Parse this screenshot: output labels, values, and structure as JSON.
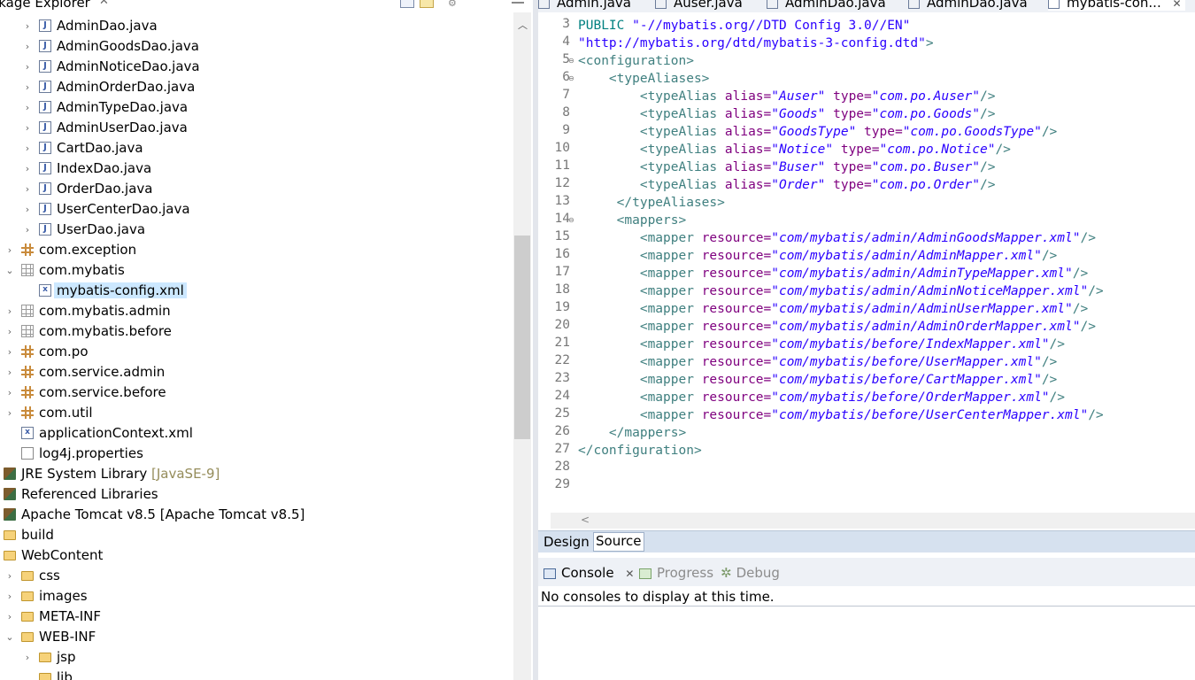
{
  "package_explorer": {
    "title": "ckage Explorer",
    "tree": [
      {
        "label": "AdminDao.java",
        "icon": "java-file-icon",
        "indent": 2,
        "twisty": "collapsed"
      },
      {
        "label": "AdminGoodsDao.java",
        "icon": "java-file-icon",
        "indent": 2,
        "twisty": "collapsed"
      },
      {
        "label": "AdminNoticeDao.java",
        "icon": "java-file-icon",
        "indent": 2,
        "twisty": "collapsed"
      },
      {
        "label": "AdminOrderDao.java",
        "icon": "java-file-icon",
        "indent": 2,
        "twisty": "collapsed"
      },
      {
        "label": "AdminTypeDao.java",
        "icon": "java-file-icon",
        "indent": 2,
        "twisty": "collapsed"
      },
      {
        "label": "AdminUserDao.java",
        "icon": "java-file-icon",
        "indent": 2,
        "twisty": "collapsed"
      },
      {
        "label": "CartDao.java",
        "icon": "java-file-icon",
        "indent": 2,
        "twisty": "collapsed"
      },
      {
        "label": "IndexDao.java",
        "icon": "java-file-icon",
        "indent": 2,
        "twisty": "collapsed"
      },
      {
        "label": "OrderDao.java",
        "icon": "java-file-icon",
        "indent": 2,
        "twisty": "collapsed"
      },
      {
        "label": "UserCenterDao.java",
        "icon": "java-file-icon",
        "indent": 2,
        "twisty": "collapsed"
      },
      {
        "label": "UserDao.java",
        "icon": "java-file-icon",
        "indent": 2,
        "twisty": "collapsed"
      },
      {
        "label": "com.exception",
        "icon": "package-icon",
        "indent": 1,
        "twisty": "collapsed"
      },
      {
        "label": "com.mybatis",
        "icon": "empty-package-icon",
        "indent": 1,
        "twisty": "expanded"
      },
      {
        "label": "mybatis-config.xml",
        "icon": "xml-file-icon",
        "indent": 2,
        "twisty": "none",
        "selected": true
      },
      {
        "label": "com.mybatis.admin",
        "icon": "empty-package-icon",
        "indent": 1,
        "twisty": "collapsed"
      },
      {
        "label": "com.mybatis.before",
        "icon": "empty-package-icon",
        "indent": 1,
        "twisty": "collapsed"
      },
      {
        "label": "com.po",
        "icon": "package-icon",
        "indent": 1,
        "twisty": "collapsed"
      },
      {
        "label": "com.service.admin",
        "icon": "package-icon",
        "indent": 1,
        "twisty": "collapsed"
      },
      {
        "label": "com.service.before",
        "icon": "package-icon",
        "indent": 1,
        "twisty": "collapsed"
      },
      {
        "label": "com.util",
        "icon": "package-icon",
        "indent": 1,
        "twisty": "collapsed"
      },
      {
        "label": "applicationContext.xml",
        "icon": "xml-file-icon",
        "indent": 1,
        "twisty": "none"
      },
      {
        "label": "log4j.properties",
        "icon": "properties-file-icon",
        "indent": 1,
        "twisty": "none"
      },
      {
        "label": "JRE System Library",
        "decoration": "[JavaSE-9]",
        "icon": "library-icon",
        "indent": 0,
        "twisty": "none"
      },
      {
        "label": "Referenced Libraries",
        "icon": "library-icon",
        "indent": 0,
        "twisty": "none"
      },
      {
        "label": "Apache Tomcat v8.5 [Apache Tomcat v8.5]",
        "icon": "library-icon",
        "indent": 0,
        "twisty": "none"
      },
      {
        "label": "build",
        "icon": "folder-icon",
        "indent": 0,
        "twisty": "none"
      },
      {
        "label": "WebContent",
        "icon": "folder-icon",
        "indent": 0,
        "twisty": "none"
      },
      {
        "label": "css",
        "icon": "folder-icon",
        "indent": 1,
        "twisty": "collapsed"
      },
      {
        "label": "images",
        "icon": "folder-icon",
        "indent": 1,
        "twisty": "collapsed"
      },
      {
        "label": "META-INF",
        "icon": "folder-icon",
        "indent": 1,
        "twisty": "collapsed"
      },
      {
        "label": "WEB-INF",
        "icon": "folder-icon",
        "indent": 1,
        "twisty": "expanded"
      },
      {
        "label": "jsp",
        "icon": "folder-icon",
        "indent": 2,
        "twisty": "collapsed"
      },
      {
        "label": "lib",
        "icon": "folder-icon",
        "indent": 2,
        "twisty": "none"
      }
    ]
  },
  "editor_tabs": [
    {
      "label": "Admin.java",
      "active": false
    },
    {
      "label": "Auser.java",
      "active": false
    },
    {
      "label": "AdminDao.java",
      "active": false
    },
    {
      "label": "AdminDao.java",
      "active": false
    },
    {
      "label": "mybatis-con...",
      "active": true
    }
  ],
  "code_lines": [
    {
      "n": "3",
      "fold": false,
      "tokens": [
        [
          "dt",
          "PUBLIC "
        ],
        [
          "str",
          "\"-//mybatis.org//DTD Config 3.0//EN\""
        ]
      ]
    },
    {
      "n": "4",
      "fold": false,
      "tokens": [
        [
          "str",
          "\"http://mybatis.org/dtd/mybatis-3-config.dtd\""
        ],
        [
          "tag",
          ">"
        ]
      ]
    },
    {
      "n": "5",
      "fold": true,
      "tokens": [
        [
          "tag",
          "<configuration>"
        ]
      ]
    },
    {
      "n": "6",
      "fold": true,
      "tokens": [
        [
          "plain",
          "    "
        ],
        [
          "tag",
          "<typeAliases>"
        ]
      ]
    },
    {
      "n": "7",
      "fold": false,
      "tokens": [
        [
          "plain",
          "        "
        ],
        [
          "tag",
          "<typeAlias "
        ],
        [
          "attr",
          "alias="
        ],
        [
          "val",
          "\"Auser\""
        ],
        [
          "plain",
          " "
        ],
        [
          "attr",
          "type="
        ],
        [
          "val",
          "\"com.po.Auser\""
        ],
        [
          "tag",
          "/>"
        ]
      ]
    },
    {
      "n": "8",
      "fold": false,
      "tokens": [
        [
          "plain",
          "        "
        ],
        [
          "tag",
          "<typeAlias "
        ],
        [
          "attr",
          "alias="
        ],
        [
          "val",
          "\"Goods\""
        ],
        [
          "plain",
          " "
        ],
        [
          "attr",
          "type="
        ],
        [
          "val",
          "\"com.po.Goods\""
        ],
        [
          "tag",
          "/>"
        ]
      ]
    },
    {
      "n": "9",
      "fold": false,
      "tokens": [
        [
          "plain",
          "        "
        ],
        [
          "tag",
          "<typeAlias "
        ],
        [
          "attr",
          "alias="
        ],
        [
          "val",
          "\"GoodsType\""
        ],
        [
          "plain",
          " "
        ],
        [
          "attr",
          "type="
        ],
        [
          "val",
          "\"com.po.GoodsType\""
        ],
        [
          "tag",
          "/>"
        ]
      ]
    },
    {
      "n": "10",
      "fold": false,
      "tokens": [
        [
          "plain",
          "        "
        ],
        [
          "tag",
          "<typeAlias "
        ],
        [
          "attr",
          "alias="
        ],
        [
          "val",
          "\"Notice\""
        ],
        [
          "plain",
          " "
        ],
        [
          "attr",
          "type="
        ],
        [
          "val",
          "\"com.po.Notice\""
        ],
        [
          "tag",
          "/>"
        ]
      ]
    },
    {
      "n": "11",
      "fold": false,
      "tokens": [
        [
          "plain",
          "        "
        ],
        [
          "tag",
          "<typeAlias "
        ],
        [
          "attr",
          "alias="
        ],
        [
          "val",
          "\"Buser\""
        ],
        [
          "plain",
          " "
        ],
        [
          "attr",
          "type="
        ],
        [
          "val",
          "\"com.po.Buser\""
        ],
        [
          "tag",
          "/>"
        ]
      ]
    },
    {
      "n": "12",
      "fold": false,
      "tokens": [
        [
          "plain",
          "        "
        ],
        [
          "tag",
          "<typeAlias "
        ],
        [
          "attr",
          "alias="
        ],
        [
          "val",
          "\"Order\""
        ],
        [
          "plain",
          " "
        ],
        [
          "attr",
          "type="
        ],
        [
          "val",
          "\"com.po.Order\""
        ],
        [
          "tag",
          "/>"
        ]
      ]
    },
    {
      "n": "13",
      "fold": false,
      "tokens": [
        [
          "plain",
          "     "
        ],
        [
          "tag",
          "</typeAliases>"
        ]
      ]
    },
    {
      "n": "14",
      "fold": true,
      "tokens": [
        [
          "plain",
          "     "
        ],
        [
          "tag",
          "<mappers>"
        ]
      ]
    },
    {
      "n": "15",
      "fold": false,
      "tokens": [
        [
          "plain",
          "        "
        ],
        [
          "tag",
          "<mapper "
        ],
        [
          "attr",
          "resource="
        ],
        [
          "val",
          "\"com/mybatis/admin/AdminGoodsMapper.xml\""
        ],
        [
          "tag",
          "/>"
        ]
      ]
    },
    {
      "n": "16",
      "fold": false,
      "tokens": [
        [
          "plain",
          "        "
        ],
        [
          "tag",
          "<mapper "
        ],
        [
          "attr",
          "resource="
        ],
        [
          "val",
          "\"com/mybatis/admin/AdminMapper.xml\""
        ],
        [
          "tag",
          "/>"
        ]
      ]
    },
    {
      "n": "17",
      "fold": false,
      "tokens": [
        [
          "plain",
          "        "
        ],
        [
          "tag",
          "<mapper "
        ],
        [
          "attr",
          "resource="
        ],
        [
          "val",
          "\"com/mybatis/admin/AdminTypeMapper.xml\""
        ],
        [
          "tag",
          "/>"
        ]
      ]
    },
    {
      "n": "18",
      "fold": false,
      "tokens": [
        [
          "plain",
          "        "
        ],
        [
          "tag",
          "<mapper "
        ],
        [
          "attr",
          "resource="
        ],
        [
          "val",
          "\"com/mybatis/admin/AdminNoticeMapper.xml\""
        ],
        [
          "tag",
          "/>"
        ]
      ]
    },
    {
      "n": "19",
      "fold": false,
      "tokens": [
        [
          "plain",
          "        "
        ],
        [
          "tag",
          "<mapper "
        ],
        [
          "attr",
          "resource="
        ],
        [
          "val",
          "\"com/mybatis/admin/AdminUserMapper.xml\""
        ],
        [
          "tag",
          "/>"
        ]
      ]
    },
    {
      "n": "20",
      "fold": false,
      "tokens": [
        [
          "plain",
          "        "
        ],
        [
          "tag",
          "<mapper "
        ],
        [
          "attr",
          "resource="
        ],
        [
          "val",
          "\"com/mybatis/admin/AdminOrderMapper.xml\""
        ],
        [
          "tag",
          "/>"
        ]
      ]
    },
    {
      "n": "21",
      "fold": false,
      "tokens": [
        [
          "plain",
          "        "
        ],
        [
          "tag",
          "<mapper "
        ],
        [
          "attr",
          "resource="
        ],
        [
          "val",
          "\"com/mybatis/before/IndexMapper.xml\""
        ],
        [
          "tag",
          "/>"
        ]
      ]
    },
    {
      "n": "22",
      "fold": false,
      "tokens": [
        [
          "plain",
          "        "
        ],
        [
          "tag",
          "<mapper "
        ],
        [
          "attr",
          "resource="
        ],
        [
          "val",
          "\"com/mybatis/before/UserMapper.xml\""
        ],
        [
          "tag",
          "/>"
        ]
      ]
    },
    {
      "n": "23",
      "fold": false,
      "tokens": [
        [
          "plain",
          "        "
        ],
        [
          "tag",
          "<mapper "
        ],
        [
          "attr",
          "resource="
        ],
        [
          "val",
          "\"com/mybatis/before/CartMapper.xml\""
        ],
        [
          "tag",
          "/>"
        ]
      ]
    },
    {
      "n": "24",
      "fold": false,
      "tokens": [
        [
          "plain",
          "        "
        ],
        [
          "tag",
          "<mapper "
        ],
        [
          "attr",
          "resource="
        ],
        [
          "val",
          "\"com/mybatis/before/OrderMapper.xml\""
        ],
        [
          "tag",
          "/>"
        ]
      ]
    },
    {
      "n": "25",
      "fold": false,
      "tokens": [
        [
          "plain",
          "        "
        ],
        [
          "tag",
          "<mapper "
        ],
        [
          "attr",
          "resource="
        ],
        [
          "val",
          "\"com/mybatis/before/UserCenterMapper.xml\""
        ],
        [
          "tag",
          "/>"
        ]
      ]
    },
    {
      "n": "26",
      "fold": false,
      "tokens": [
        [
          "plain",
          "    "
        ],
        [
          "tag",
          "</mappers>"
        ]
      ]
    },
    {
      "n": "27",
      "fold": false,
      "tokens": [
        [
          "tag",
          "</configuration>"
        ]
      ]
    },
    {
      "n": "28",
      "fold": false,
      "tokens": []
    },
    {
      "n": "29",
      "fold": false,
      "tokens": []
    }
  ],
  "design_source_tabs": {
    "design": "Design",
    "source": "Source"
  },
  "console": {
    "tab_console": "Console",
    "tab_progress": "Progress",
    "tab_debug": "Debug",
    "message": "No consoles to display at this time."
  },
  "colors": {
    "tag": "#3f7f7f",
    "attr": "#7f007f",
    "value": "#2a00ff",
    "doctype": "#008080",
    "selection": "#cce8ff"
  }
}
